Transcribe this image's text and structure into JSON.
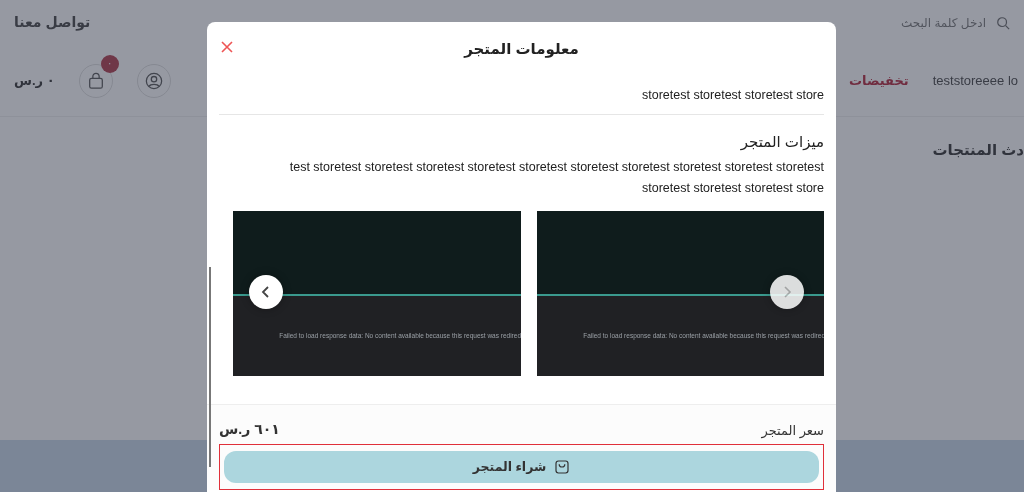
{
  "page": {
    "search": {
      "placeholder": "ادخل كلمة البحث"
    },
    "contact_link": "تواصل معنا",
    "nav": [
      {
        "label": "teststoreeee lo",
        "selected": false
      },
      {
        "label": "تخفيضات",
        "selected": true
      }
    ],
    "cart": {
      "badge": "٠",
      "total": "٠ ر.س"
    },
    "section_title": "دث المنتجات"
  },
  "modal": {
    "title": "معلومات المتجر",
    "description": "storetest storetest storetest store",
    "features_title": "ميزات المتجر",
    "features_text": "test storetest storetest storetest storetest storetest storetest storetest storetest storetest storetest storetest storetest storetest store",
    "slides": [
      {
        "caption": "Failed to load response data: No content available because this request was redired"
      },
      {
        "caption": "Failed to load response data: No content available because this request was redired"
      }
    ],
    "price_label": "سعر المتجر",
    "price": "٦٠١ ر.س",
    "buy_button": "شراء المتجر"
  }
}
